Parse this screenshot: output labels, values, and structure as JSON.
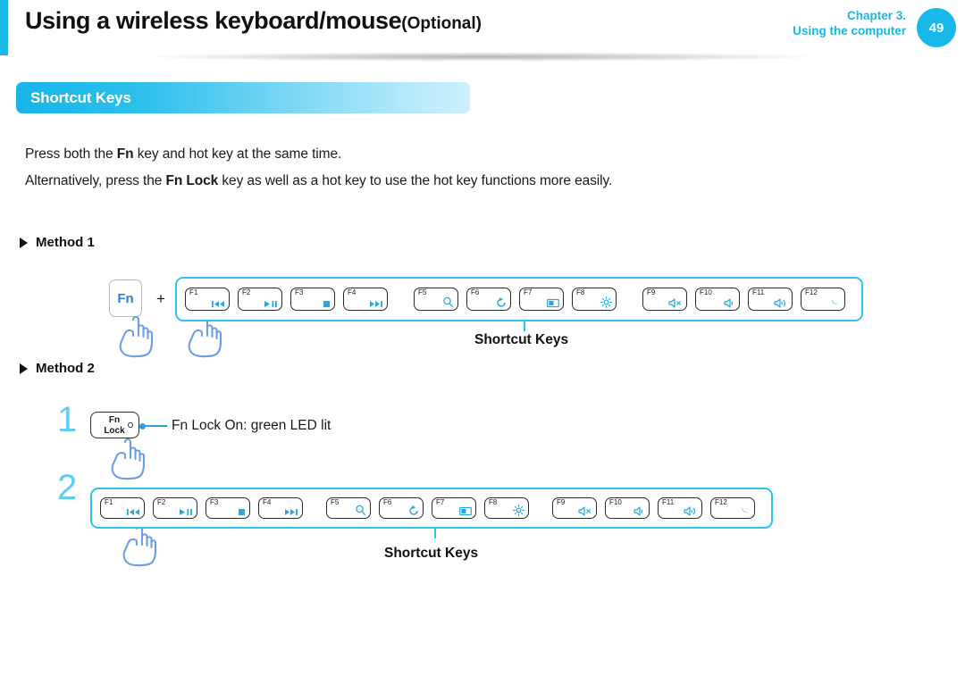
{
  "header": {
    "title": "Using a wireless keyboard/mouse",
    "title_suffix": "(Optional)",
    "chapter_line1": "Chapter 3.",
    "chapter_line2": "Using the computer",
    "page_number": "49",
    "accent_color": "#18b8e8"
  },
  "section": {
    "title": "Shortcut Keys"
  },
  "body": {
    "line1_a": "Press both the ",
    "line1_b": "Fn",
    "line1_c": " key and hot key at the same time.",
    "line2_a": "Alternatively, press the ",
    "line2_b": "Fn Lock",
    "line2_c": " key as well as a hot key to use the hot key functions more easily."
  },
  "method1": {
    "heading": "Method 1",
    "fn_key_label": "Fn",
    "plus": "+",
    "callout": "Shortcut Keys"
  },
  "method2": {
    "heading": "Method 2",
    "step1_number": "1",
    "step2_number": "2",
    "fnlock_line1": "Fn",
    "fnlock_line2": "Lock",
    "led_text": "Fn Lock On: green LED lit",
    "callout": "Shortcut Keys"
  },
  "keys": [
    {
      "label": "F1",
      "icon": "prev-track-icon"
    },
    {
      "label": "F2",
      "icon": "play-pause-icon"
    },
    {
      "label": "F3",
      "icon": "stop-icon"
    },
    {
      "label": "F4",
      "icon": "next-track-icon"
    },
    {
      "label": "F5",
      "icon": "search-icon"
    },
    {
      "label": "F6",
      "icon": "refresh-icon"
    },
    {
      "label": "F7",
      "icon": "display-switch-icon"
    },
    {
      "label": "F8",
      "icon": "brightness-icon"
    },
    {
      "label": "F9",
      "icon": "volume-mute-icon"
    },
    {
      "label": "F10",
      "icon": "volume-down-icon"
    },
    {
      "label": "F11",
      "icon": "volume-up-icon"
    },
    {
      "label": "F12",
      "icon": "sleep-moon-icon"
    }
  ],
  "colors": {
    "accent_cyan": "#18b8e8",
    "strip_border": "#2cc4f0",
    "glyph_blue": "#29a8e0",
    "hand_blue": "#6699e8",
    "step_number": "#63cdf0"
  }
}
